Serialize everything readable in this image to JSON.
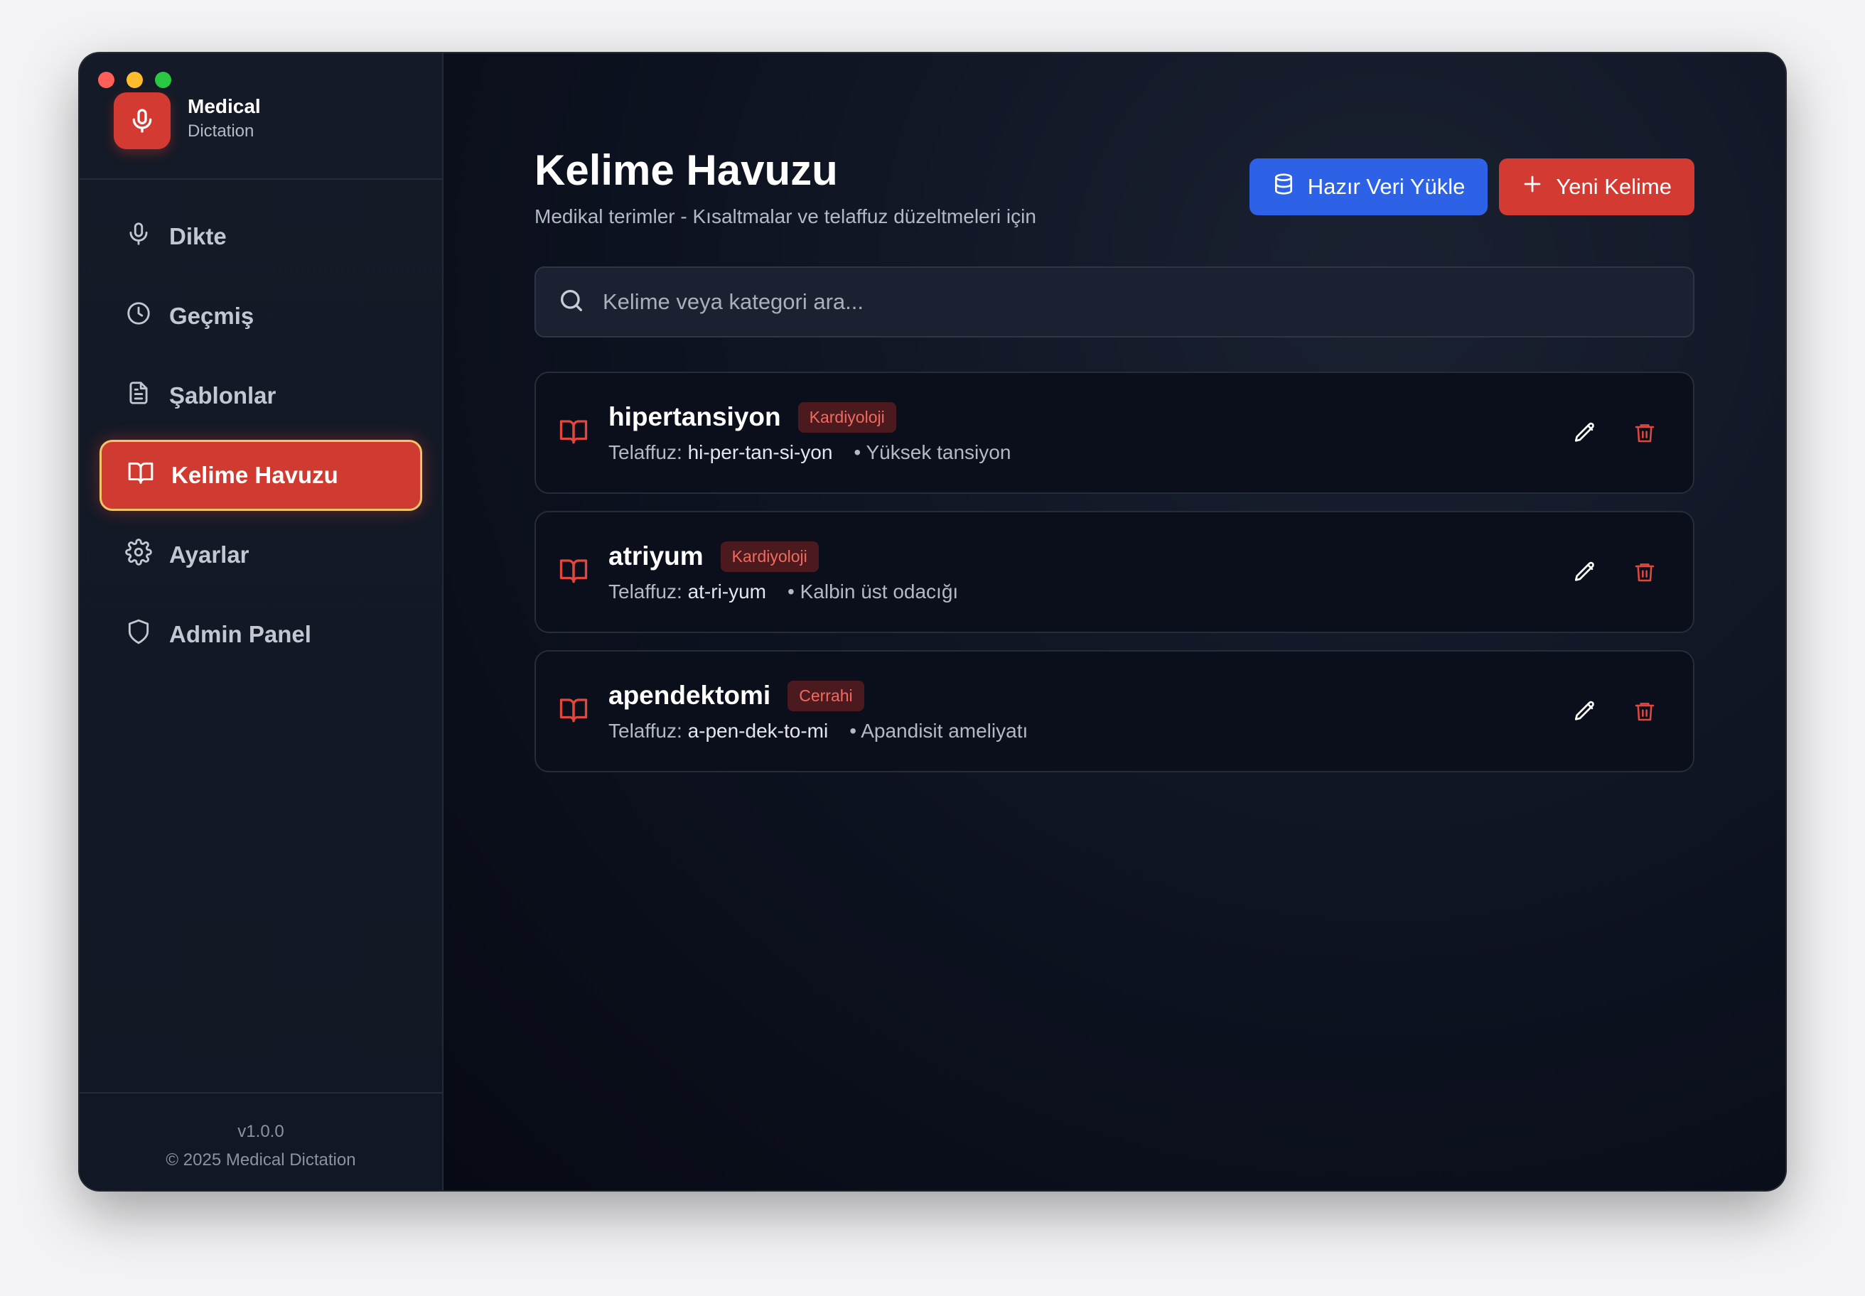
{
  "app": {
    "name": "Medical",
    "subtitle": "Dictation",
    "version": "v1.0.0",
    "copyright": "© 2025 Medical Dictation"
  },
  "sidebar": {
    "items": [
      {
        "label": "Dikte",
        "icon": "mic-icon",
        "active": false
      },
      {
        "label": "Geçmiş",
        "icon": "clock-icon",
        "active": false
      },
      {
        "label": "Şablonlar",
        "icon": "file-text-icon",
        "active": false
      },
      {
        "label": "Kelime Havuzu",
        "icon": "book-open-icon",
        "active": true
      },
      {
        "label": "Ayarlar",
        "icon": "gear-icon",
        "active": false
      },
      {
        "label": "Admin Panel",
        "icon": "shield-icon",
        "active": false
      }
    ]
  },
  "page": {
    "title": "Kelime Havuzu",
    "subtitle": "Medikal terimler - Kısaltmalar ve telaffuz düzeltmeleri için"
  },
  "toolbar": {
    "load_label": "Hazır Veri Yükle",
    "new_label": "Yeni Kelime"
  },
  "search": {
    "placeholder": "Kelime veya kategori ara...",
    "value": ""
  },
  "pron_label": "Telaffuz:",
  "words": [
    {
      "term": "hipertansiyon",
      "category": "Kardiyoloji",
      "pronunciation": "hi-per-tan-si-yon",
      "meaning": "• Yüksek tansiyon"
    },
    {
      "term": "atriyum",
      "category": "Kardiyoloji",
      "pronunciation": "at-ri-yum",
      "meaning": "• Kalbin üst odacığı"
    },
    {
      "term": "apendektomi",
      "category": "Cerrahi",
      "pronunciation": "a-pen-dek-to-mi",
      "meaning": "• Apandisit ameliyatı"
    }
  ],
  "colors": {
    "accent": "#d23a32",
    "primary_blue": "#2e62e6",
    "badge_bg": "#4a1a1f",
    "badge_text": "#f26a5e"
  }
}
